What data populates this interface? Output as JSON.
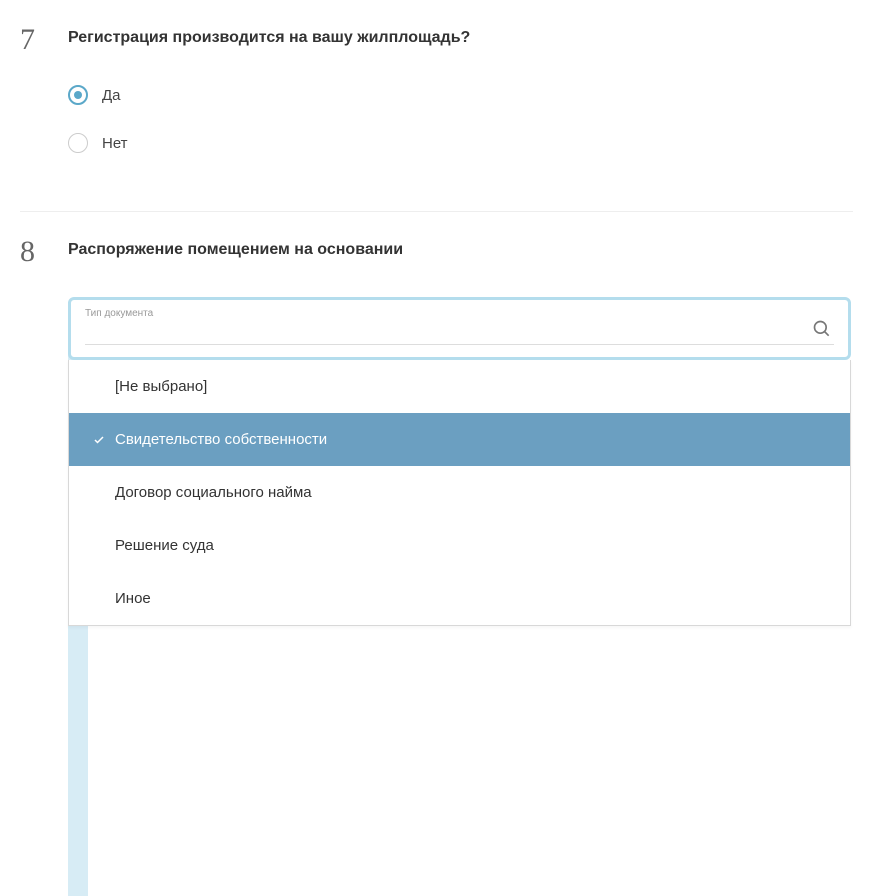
{
  "q7": {
    "number": "7",
    "title": "Регистрация производится на вашу жилплощадь?",
    "options": [
      {
        "label": "Да",
        "selected": true
      },
      {
        "label": "Нет",
        "selected": false
      }
    ]
  },
  "q8": {
    "number": "8",
    "title": "Распоряжение помещением на основании",
    "select_label": "Тип документа",
    "options": [
      {
        "label": "[Не выбрано]",
        "selected": false
      },
      {
        "label": "Свидетельство собственности",
        "selected": true
      },
      {
        "label": "Договор социального найма",
        "selected": false
      },
      {
        "label": "Решение суда",
        "selected": false
      },
      {
        "label": "Иное",
        "selected": false
      }
    ]
  }
}
